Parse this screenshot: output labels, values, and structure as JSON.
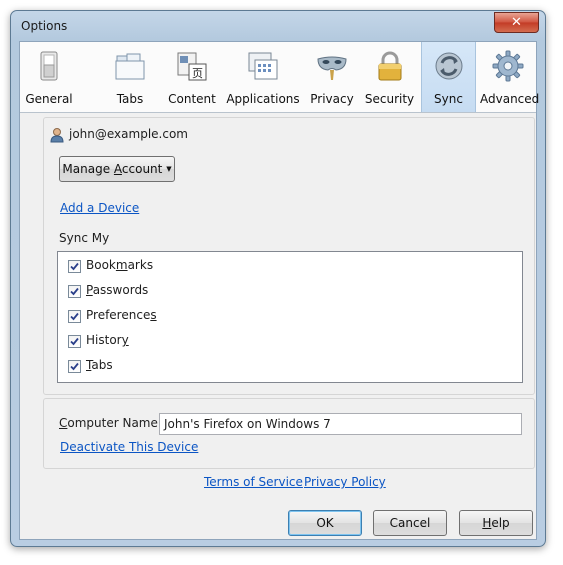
{
  "window": {
    "title": "Options",
    "close_glyph": "✕"
  },
  "toolbar": {
    "tabs": [
      {
        "label": "General",
        "icon": "general-switch-icon"
      },
      {
        "label": "Tabs",
        "icon": "tabs-icon"
      },
      {
        "label": "Content",
        "icon": "content-icon"
      },
      {
        "label": "Applications",
        "icon": "applications-icon"
      },
      {
        "label": "Privacy",
        "icon": "privacy-mask-icon"
      },
      {
        "label": "Security",
        "icon": "padlock-icon"
      },
      {
        "label": "Sync",
        "icon": "sync-icon",
        "selected": true
      },
      {
        "label": "Advanced",
        "icon": "gear-icon"
      }
    ]
  },
  "sync": {
    "account_email": "john@example.com",
    "manage_account": {
      "before": "Manage ",
      "accel": "A",
      "after": "ccount"
    },
    "add_device_link": "Add a Device",
    "sync_my_label": "Sync My",
    "items": [
      {
        "before": "Book",
        "accel": "m",
        "after": "arks",
        "checked": true
      },
      {
        "before": "",
        "accel": "P",
        "after": "asswords",
        "checked": true
      },
      {
        "before": "Preference",
        "accel": "s",
        "after": "",
        "checked": true
      },
      {
        "before": "Histor",
        "accel": "y",
        "after": "",
        "checked": true
      },
      {
        "before": "",
        "accel": "T",
        "after": "abs",
        "checked": true
      }
    ],
    "computer_name_label": {
      "before": "",
      "accel": "C",
      "after": "omputer Name:"
    },
    "computer_name_value": "John's Firefox on Windows 7",
    "deactivate_link": "Deactivate This Device"
  },
  "footer": {
    "terms_link": "Terms of Service",
    "privacy_link": "Privacy Policy",
    "ok_label": "OK",
    "cancel_label": "Cancel",
    "help": {
      "before": "",
      "accel": "H",
      "after": "elp"
    }
  }
}
